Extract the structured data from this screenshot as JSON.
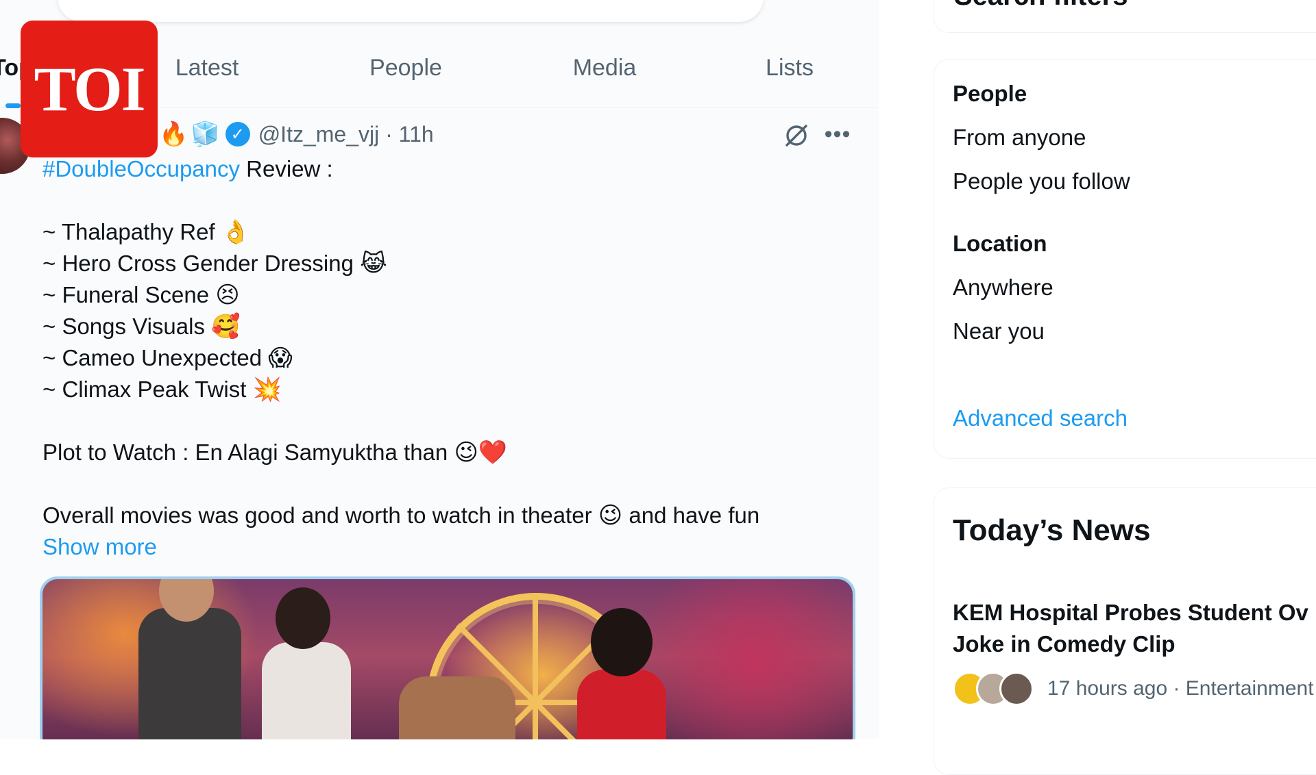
{
  "tabs": [
    {
      "label": "Top",
      "active": true
    },
    {
      "label": "Latest",
      "active": false
    },
    {
      "label": "People",
      "active": false
    },
    {
      "label": "Media",
      "active": false
    },
    {
      "label": "Lists",
      "active": false
    }
  ],
  "tweet": {
    "name_emojis": [
      "🔥",
      "🧊"
    ],
    "handle": "@Itz_me_vjj",
    "separator": " · ",
    "time": "11h",
    "hashtag": "#DoubleOccupancy",
    "title_suffix": " Review :",
    "items": [
      {
        "text": "~ Thalapathy Ref ",
        "emoji": "👌"
      },
      {
        "text": "~ Hero Cross Gender Dressing ",
        "emoji": "😹"
      },
      {
        "text": "~ Funeral Scene ",
        "emoji": "😣"
      },
      {
        "text": "~ Songs Visuals ",
        "emoji": "🥰"
      },
      {
        "text": "~ Cameo Unexpected ",
        "emoji": "😱"
      },
      {
        "text": "~ Climax Peak Twist ",
        "emoji": "💥"
      }
    ],
    "plot_line": "Plot to Watch : En Alagi Samyuktha than ",
    "plot_emojis": "😉❤️",
    "overall_before": "Overall movies was good and worth to watch in theater ",
    "overall_emoji": "😉",
    "overall_after": " and have fun",
    "show_more": "Show more"
  },
  "sidebar": {
    "filters_title": "Search filters",
    "people_title": "People",
    "people_options": [
      "From anyone",
      "People you follow"
    ],
    "location_title": "Location",
    "location_options": [
      "Anywhere",
      "Near you"
    ],
    "advanced_search": "Advanced search",
    "news_title": "Today’s News",
    "news_headline_1": "KEM Hospital Probes Student Ov",
    "news_headline_2": "Joke in Comedy Clip",
    "news_meta": "17 hours ago · Entertainment ·"
  },
  "logo": {
    "text": "TOI"
  },
  "colors": {
    "accent": "#1d9bf0",
    "logo_red": "#e41d16",
    "secondary_text": "#536471"
  }
}
